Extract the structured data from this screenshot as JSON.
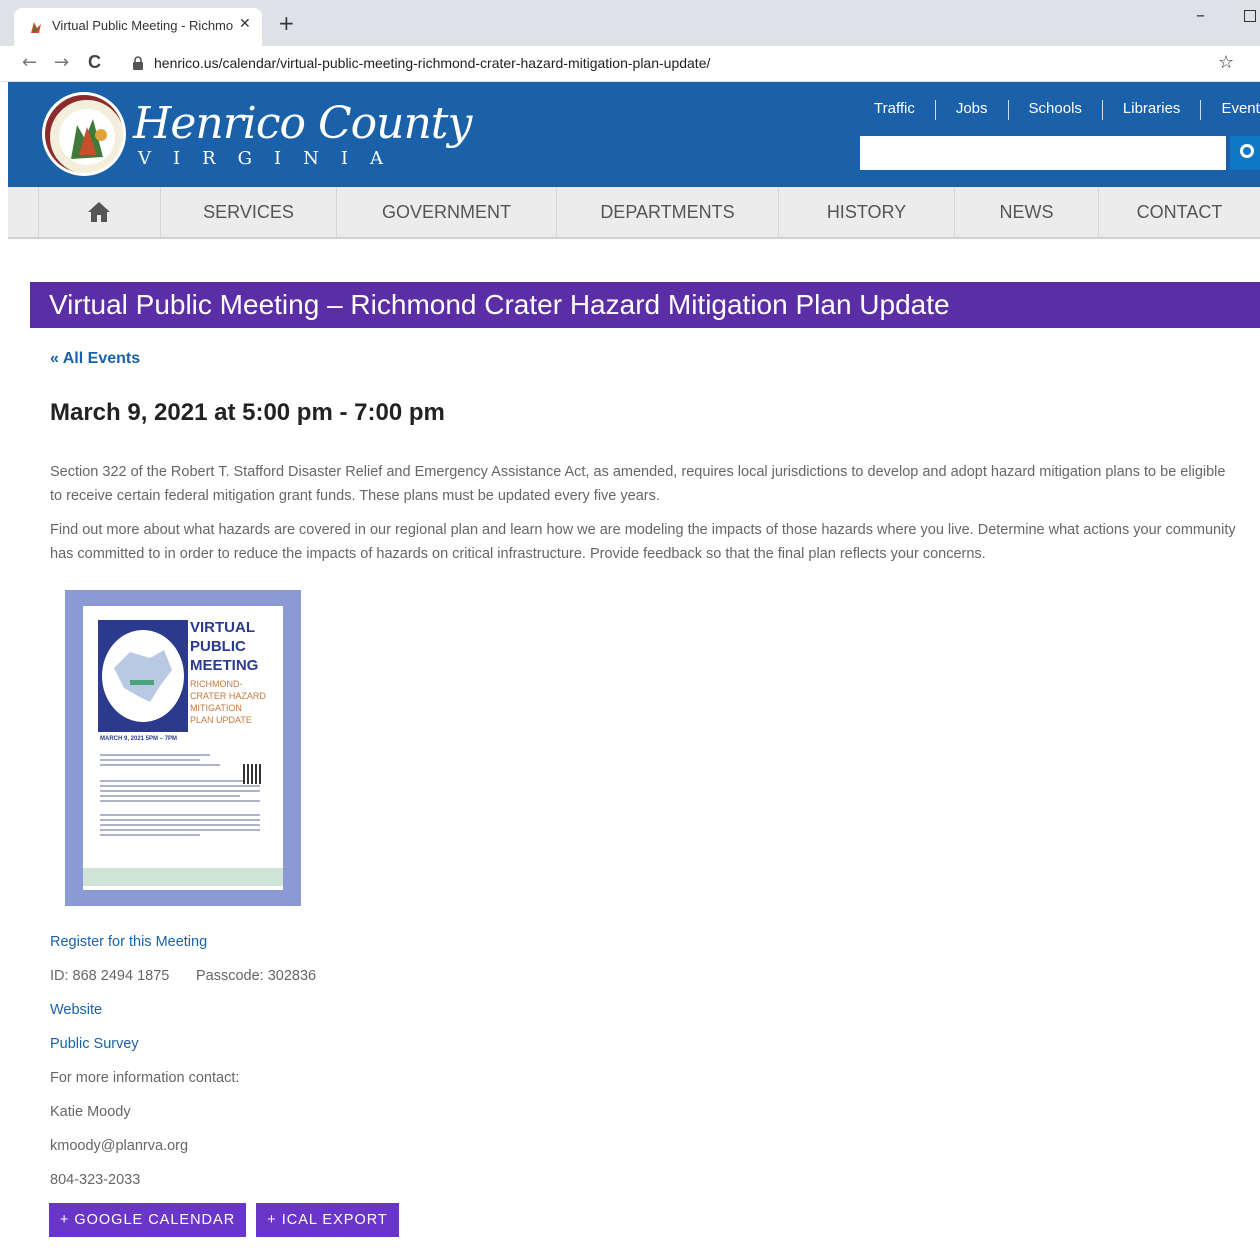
{
  "browser": {
    "tab_title": "Virtual Public Meeting - Richmo",
    "tab_close": "✕",
    "new_tab": "+",
    "url": "henrico.us/calendar/virtual-public-meeting-richmond-crater-hazard-mitigation-plan-update/",
    "back": "←",
    "forward": "→",
    "reload": "C",
    "star": "☆",
    "minimize": "–"
  },
  "header": {
    "brand_name": "Henrico County",
    "brand_state": "VIRGINIA",
    "quicklinks": [
      "Traffic",
      "Jobs",
      "Schools",
      "Libraries",
      "Events"
    ],
    "search_placeholder": ""
  },
  "nav": {
    "items": [
      "SERVICES",
      "GOVERNMENT",
      "DEPARTMENTS",
      "HISTORY",
      "NEWS",
      "CONTACT"
    ]
  },
  "page": {
    "title": "Virtual Public Meeting – Richmond Crater Hazard Mitigation Plan Update",
    "all_events": "« All Events",
    "date": "March 9, 2021 at 5:00 pm - 7:00 pm",
    "paragraph1": "Section 322 of the Robert T. Stafford Disaster Relief and Emergency Assistance Act, as amended, requires local jurisdictions to develop and adopt hazard mitigation plans to be eligible to receive certain federal mitigation grant funds. These plans must be updated every five years.",
    "paragraph2": "Find out more about what hazards are covered in our regional plan and learn how we are modeling the impacts of those hazards where you live. Determine what actions your community has committed to in order to reduce the impacts of hazards on critical infrastructure. Provide feedback so that the final plan reflects your concerns."
  },
  "flyer": {
    "heading": [
      "VIRTUAL",
      "PUBLIC",
      "MEETING"
    ],
    "subheading": [
      "RICHMOND-",
      "CRATER HAZARD",
      "MITIGATION",
      "PLAN UPDATE"
    ],
    "date": "MARCH 9, 2021  5PM – 7PM"
  },
  "info": {
    "register": "Register for this Meeting",
    "meeting_id": "ID: 868 2494 1875",
    "passcode": "Passcode: 302836",
    "website": "Website",
    "survey": "Public Survey",
    "contact_label": "For more information contact:",
    "contact_name": "Katie Moody",
    "contact_email": "kmoody@planrva.org",
    "contact_phone": "804-323-2033"
  },
  "buttons": {
    "google": "+ GOOGLE CALENDAR",
    "ical": "+ ICAL EXPORT"
  },
  "colors": {
    "header_blue": "#1a61a9",
    "title_purple": "#5b2ea6",
    "button_purple": "#6a35c9"
  }
}
